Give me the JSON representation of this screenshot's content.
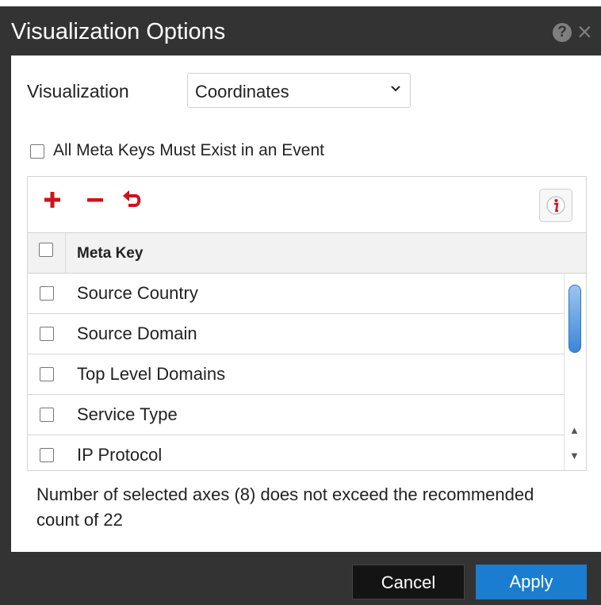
{
  "dialog": {
    "title": "Visualization Options"
  },
  "visualization": {
    "label": "Visualization",
    "selected": "Coordinates"
  },
  "all_meta_keys": {
    "label": "All Meta Keys Must Exist in an Event",
    "checked": false
  },
  "grid": {
    "column_header": "Meta Key",
    "rows": [
      {
        "label": "Source Country"
      },
      {
        "label": "Source Domain"
      },
      {
        "label": "Top Level Domains"
      },
      {
        "label": "Service Type"
      },
      {
        "label": "IP Protocol"
      }
    ]
  },
  "message": {
    "text": "Number of selected axes (8) does not exceed the recommended count of 22"
  },
  "footer": {
    "cancel_label": "Cancel",
    "apply_label": "Apply"
  },
  "colors": {
    "accent": "#1b7dd0",
    "danger": "#d0121b",
    "titlebar": "#333333"
  }
}
